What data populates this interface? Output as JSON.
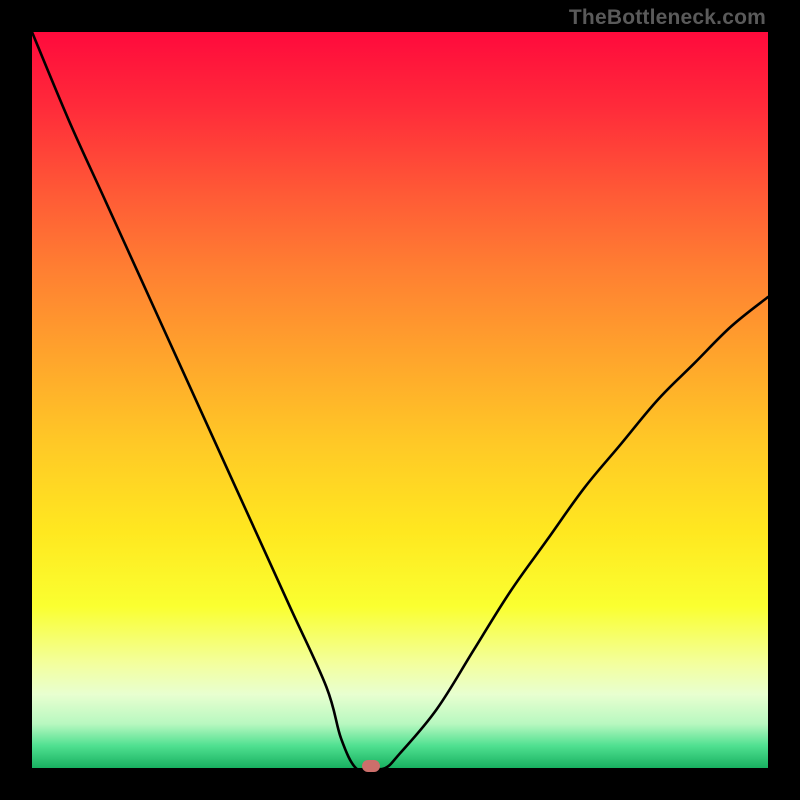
{
  "watermark": "TheBottleneck.com",
  "chart_data": {
    "type": "line",
    "title": "",
    "xlabel": "",
    "ylabel": "",
    "ylim": [
      0,
      100
    ],
    "x": [
      0,
      5,
      10,
      15,
      20,
      25,
      30,
      35,
      40,
      42,
      44,
      46,
      48,
      50,
      55,
      60,
      65,
      70,
      75,
      80,
      85,
      90,
      95,
      100
    ],
    "values": [
      100,
      88,
      77,
      66,
      55,
      44,
      33,
      22,
      11,
      4,
      0,
      0,
      0,
      2,
      8,
      16,
      24,
      31,
      38,
      44,
      50,
      55,
      60,
      64
    ],
    "marker": {
      "x": 46,
      "y": 0
    },
    "colors": {
      "curve": "#000000",
      "marker": "#cc6f6b",
      "gradient_top": "#ff0a3c",
      "gradient_bottom": "#18b060"
    }
  }
}
